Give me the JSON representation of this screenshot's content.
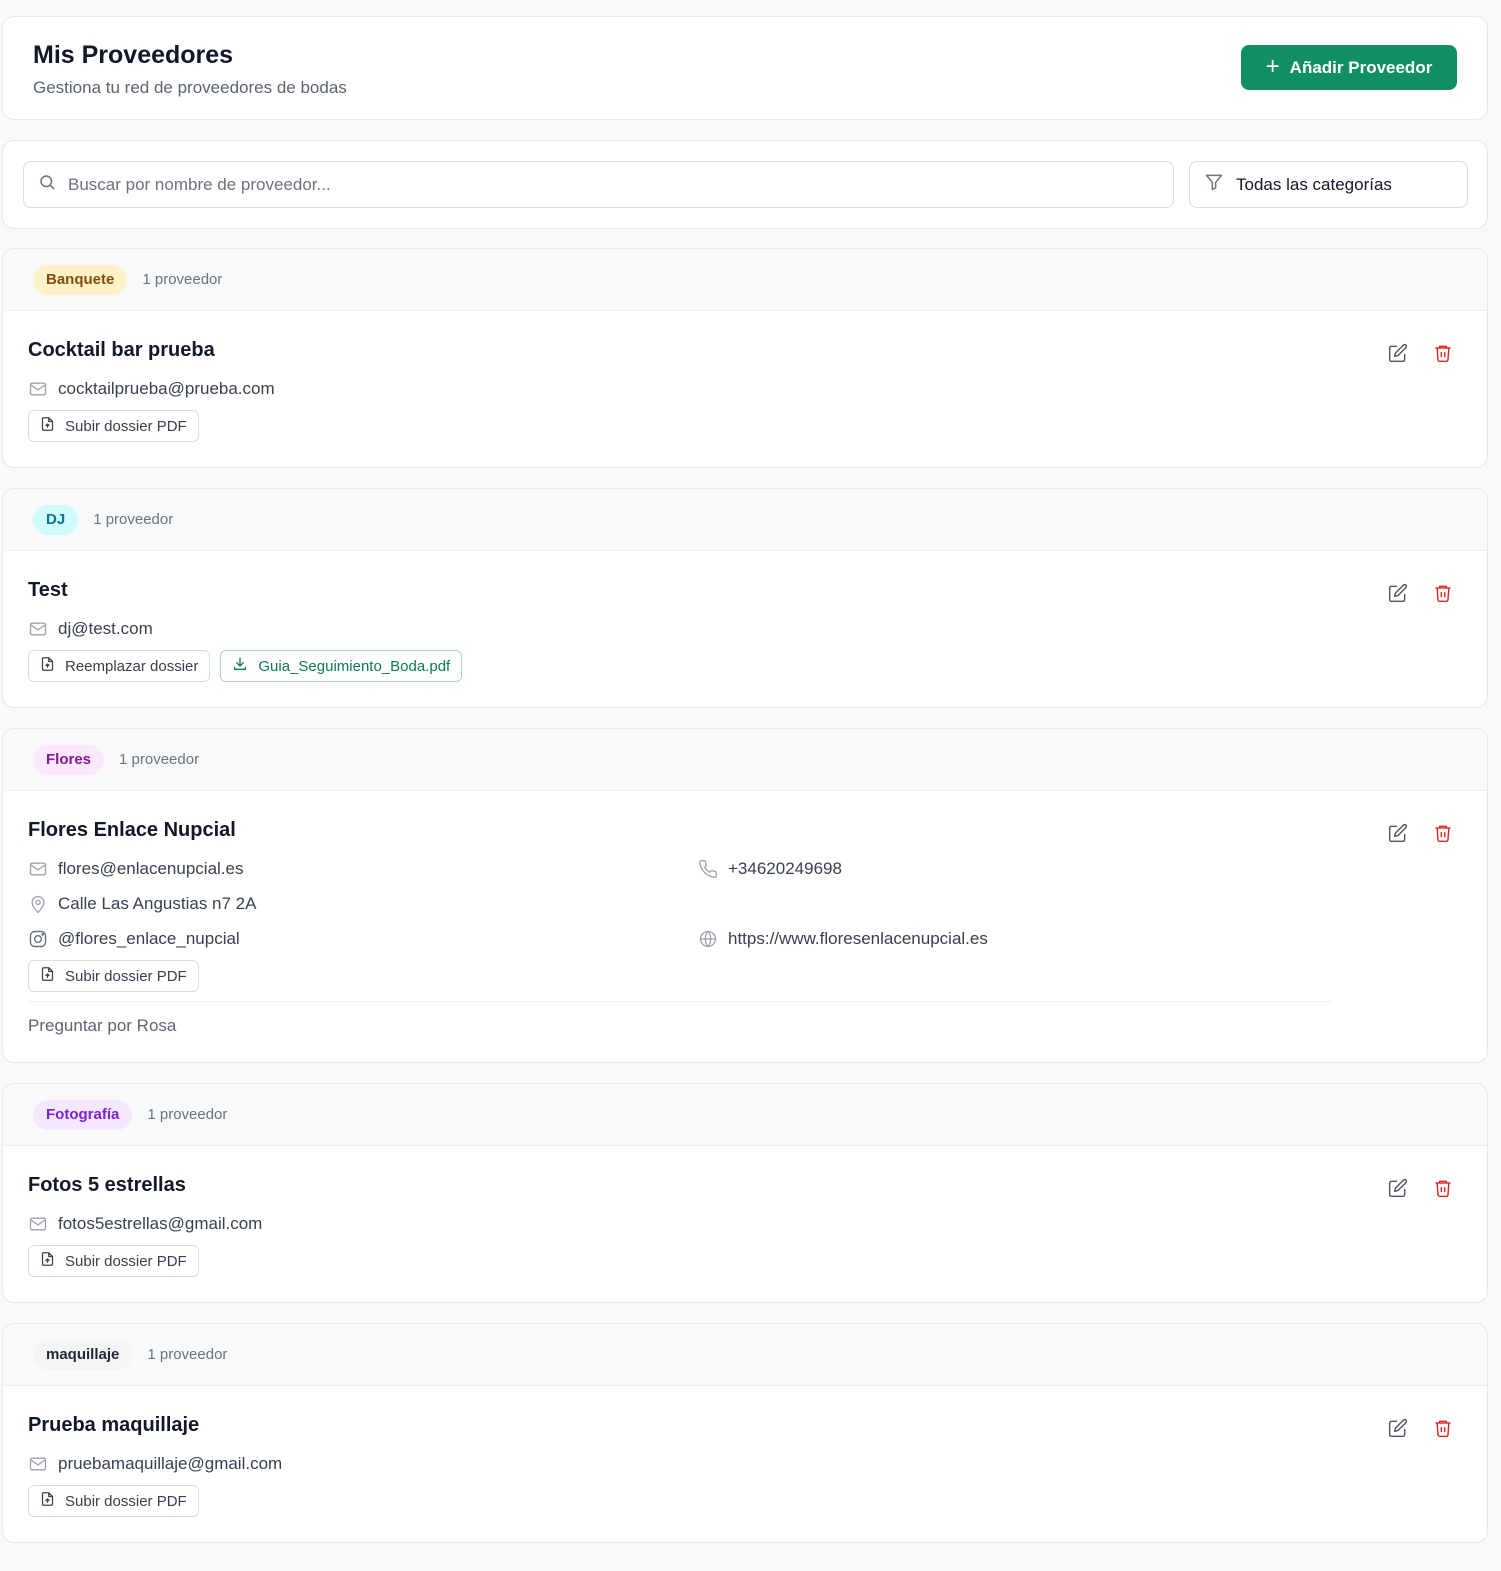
{
  "header": {
    "title": "Mis Proveedores",
    "subtitle": "Gestiona tu red de proveedores de bodas",
    "add_button": "Añadir Proveedor"
  },
  "filters": {
    "search_placeholder": "Buscar por nombre de proveedor...",
    "search_value": "",
    "category_selected": "Todas las categorías"
  },
  "groups": [
    {
      "category": "Banquete",
      "badge_bg": "#fdf1c7",
      "badge_fg": "#854d0e",
      "count": "1 proveedor",
      "vendor": {
        "name": "Cocktail bar prueba",
        "email": "cocktailprueba@prueba.com",
        "upload_label": "Subir dossier PDF"
      }
    },
    {
      "category": "DJ",
      "badge_bg": "#cffafe",
      "badge_fg": "#0e7490",
      "count": "1 proveedor",
      "vendor": {
        "name": "Test",
        "email": "dj@test.com",
        "upload_label": "Reemplazar dossier",
        "file_label": "Guia_Seguimiento_Boda.pdf"
      }
    },
    {
      "category": "Flores",
      "badge_bg": "#fae8ff",
      "badge_fg": "#86198f",
      "count": "1 proveedor",
      "vendor": {
        "name": "Flores Enlace Nupcial",
        "email": "flores@enlacenupcial.es",
        "phone": "+34620249698",
        "address": "Calle Las Angustias n7 2A",
        "instagram": "@flores_enlace_nupcial",
        "website": "https://www.floresenlacenupcial.es",
        "upload_label": "Subir dossier PDF",
        "notes": "Preguntar por Rosa"
      }
    },
    {
      "category": "Fotografía",
      "badge_bg": "#f3e8ff",
      "badge_fg": "#7e22ce",
      "count": "1 proveedor",
      "vendor": {
        "name": "Fotos 5 estrellas",
        "email": "fotos5estrellas@gmail.com",
        "upload_label": "Subir dossier PDF"
      }
    },
    {
      "category": "maquillaje",
      "badge_bg": "#f3f4f6",
      "badge_fg": "#1f2937",
      "count": "1 proveedor",
      "vendor": {
        "name": "Prueba maquillaje",
        "email": "pruebamaquillaje@gmail.com",
        "upload_label": "Subir dossier PDF"
      }
    }
  ],
  "icons": {
    "search": "search-icon",
    "filter": "filter-icon",
    "mail": "mail-icon",
    "phone": "phone-icon",
    "location": "map-pin-icon",
    "instagram": "instagram-icon",
    "globe": "globe-icon",
    "upload": "file-upload-icon",
    "download": "download-icon",
    "edit": "edit-icon",
    "delete": "trash-icon"
  },
  "colors": {
    "accent": "#0f8f63",
    "delete": "#dc2626"
  }
}
